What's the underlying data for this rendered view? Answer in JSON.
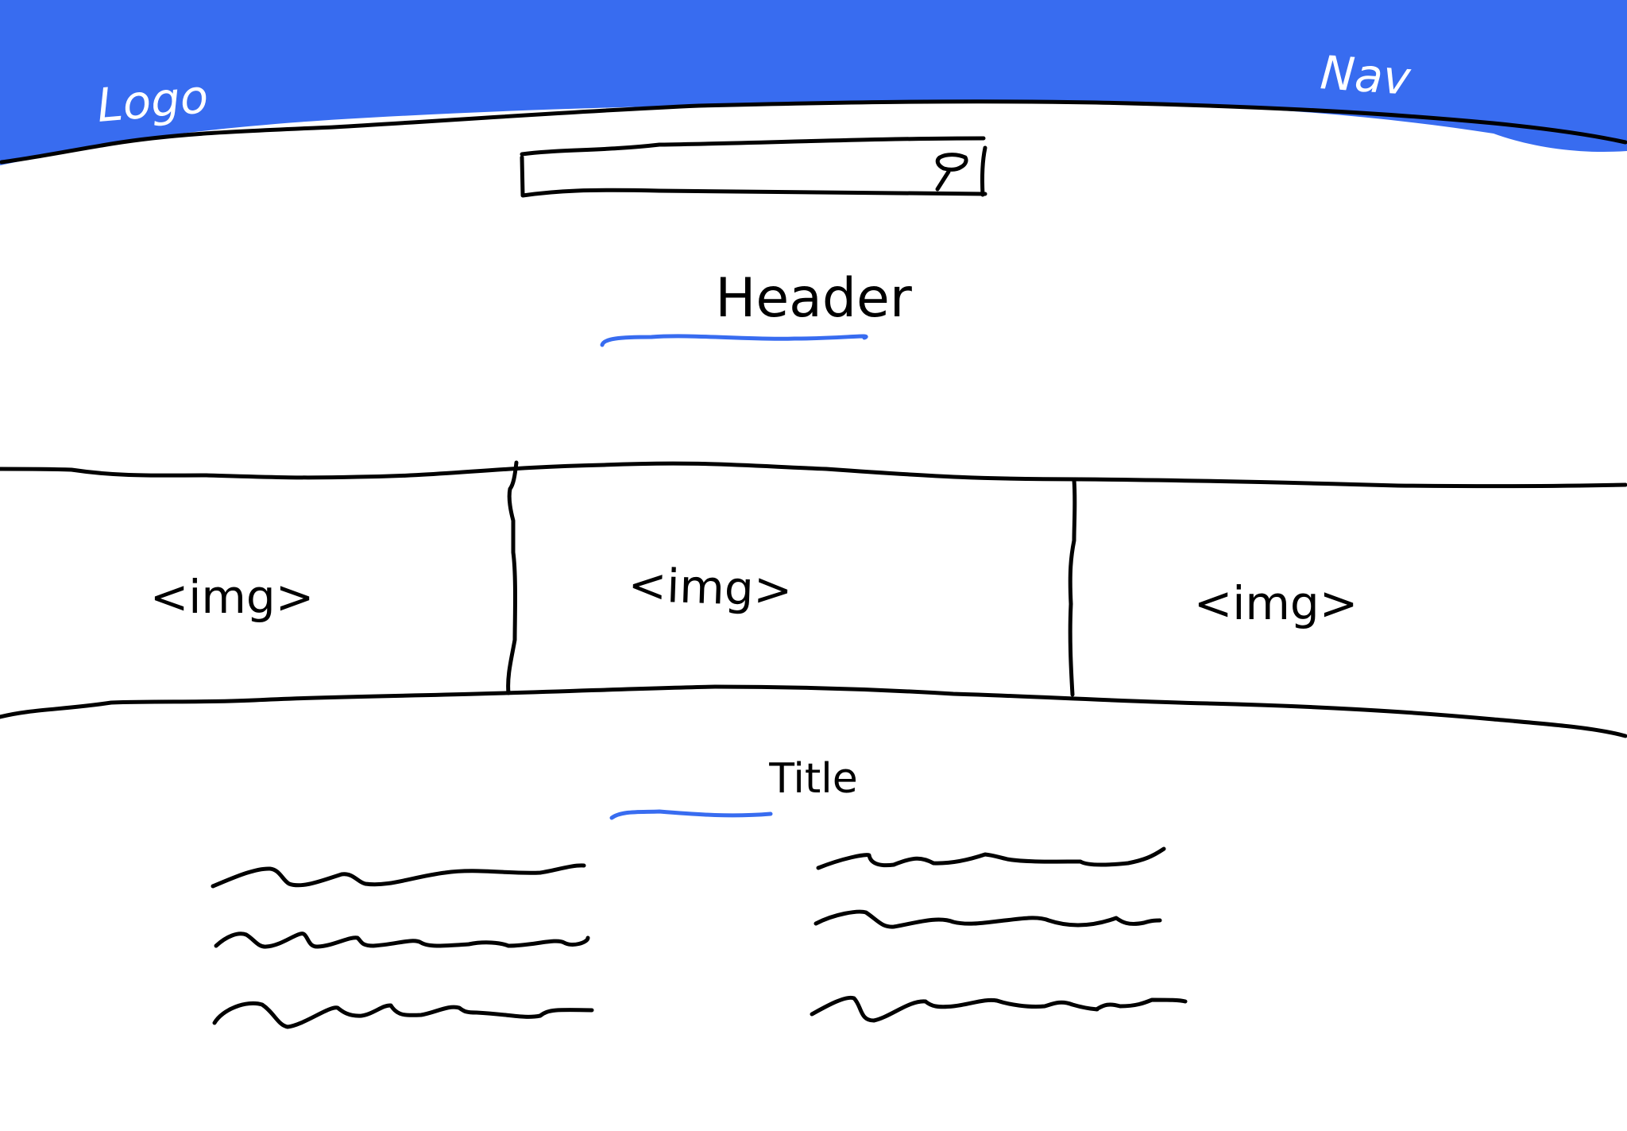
{
  "navbar": {
    "logo": "Logo",
    "nav": "Nav"
  },
  "search": {
    "icon": "search-icon"
  },
  "header": {
    "title": "Header"
  },
  "gallery": {
    "images": [
      {
        "label": "<img>"
      },
      {
        "label": "<img>"
      },
      {
        "label": "<img>"
      }
    ]
  },
  "content": {
    "title": "Title"
  },
  "colors": {
    "accent": "#386cf0",
    "nav_text": "#ffffff",
    "ink": "#000000"
  }
}
